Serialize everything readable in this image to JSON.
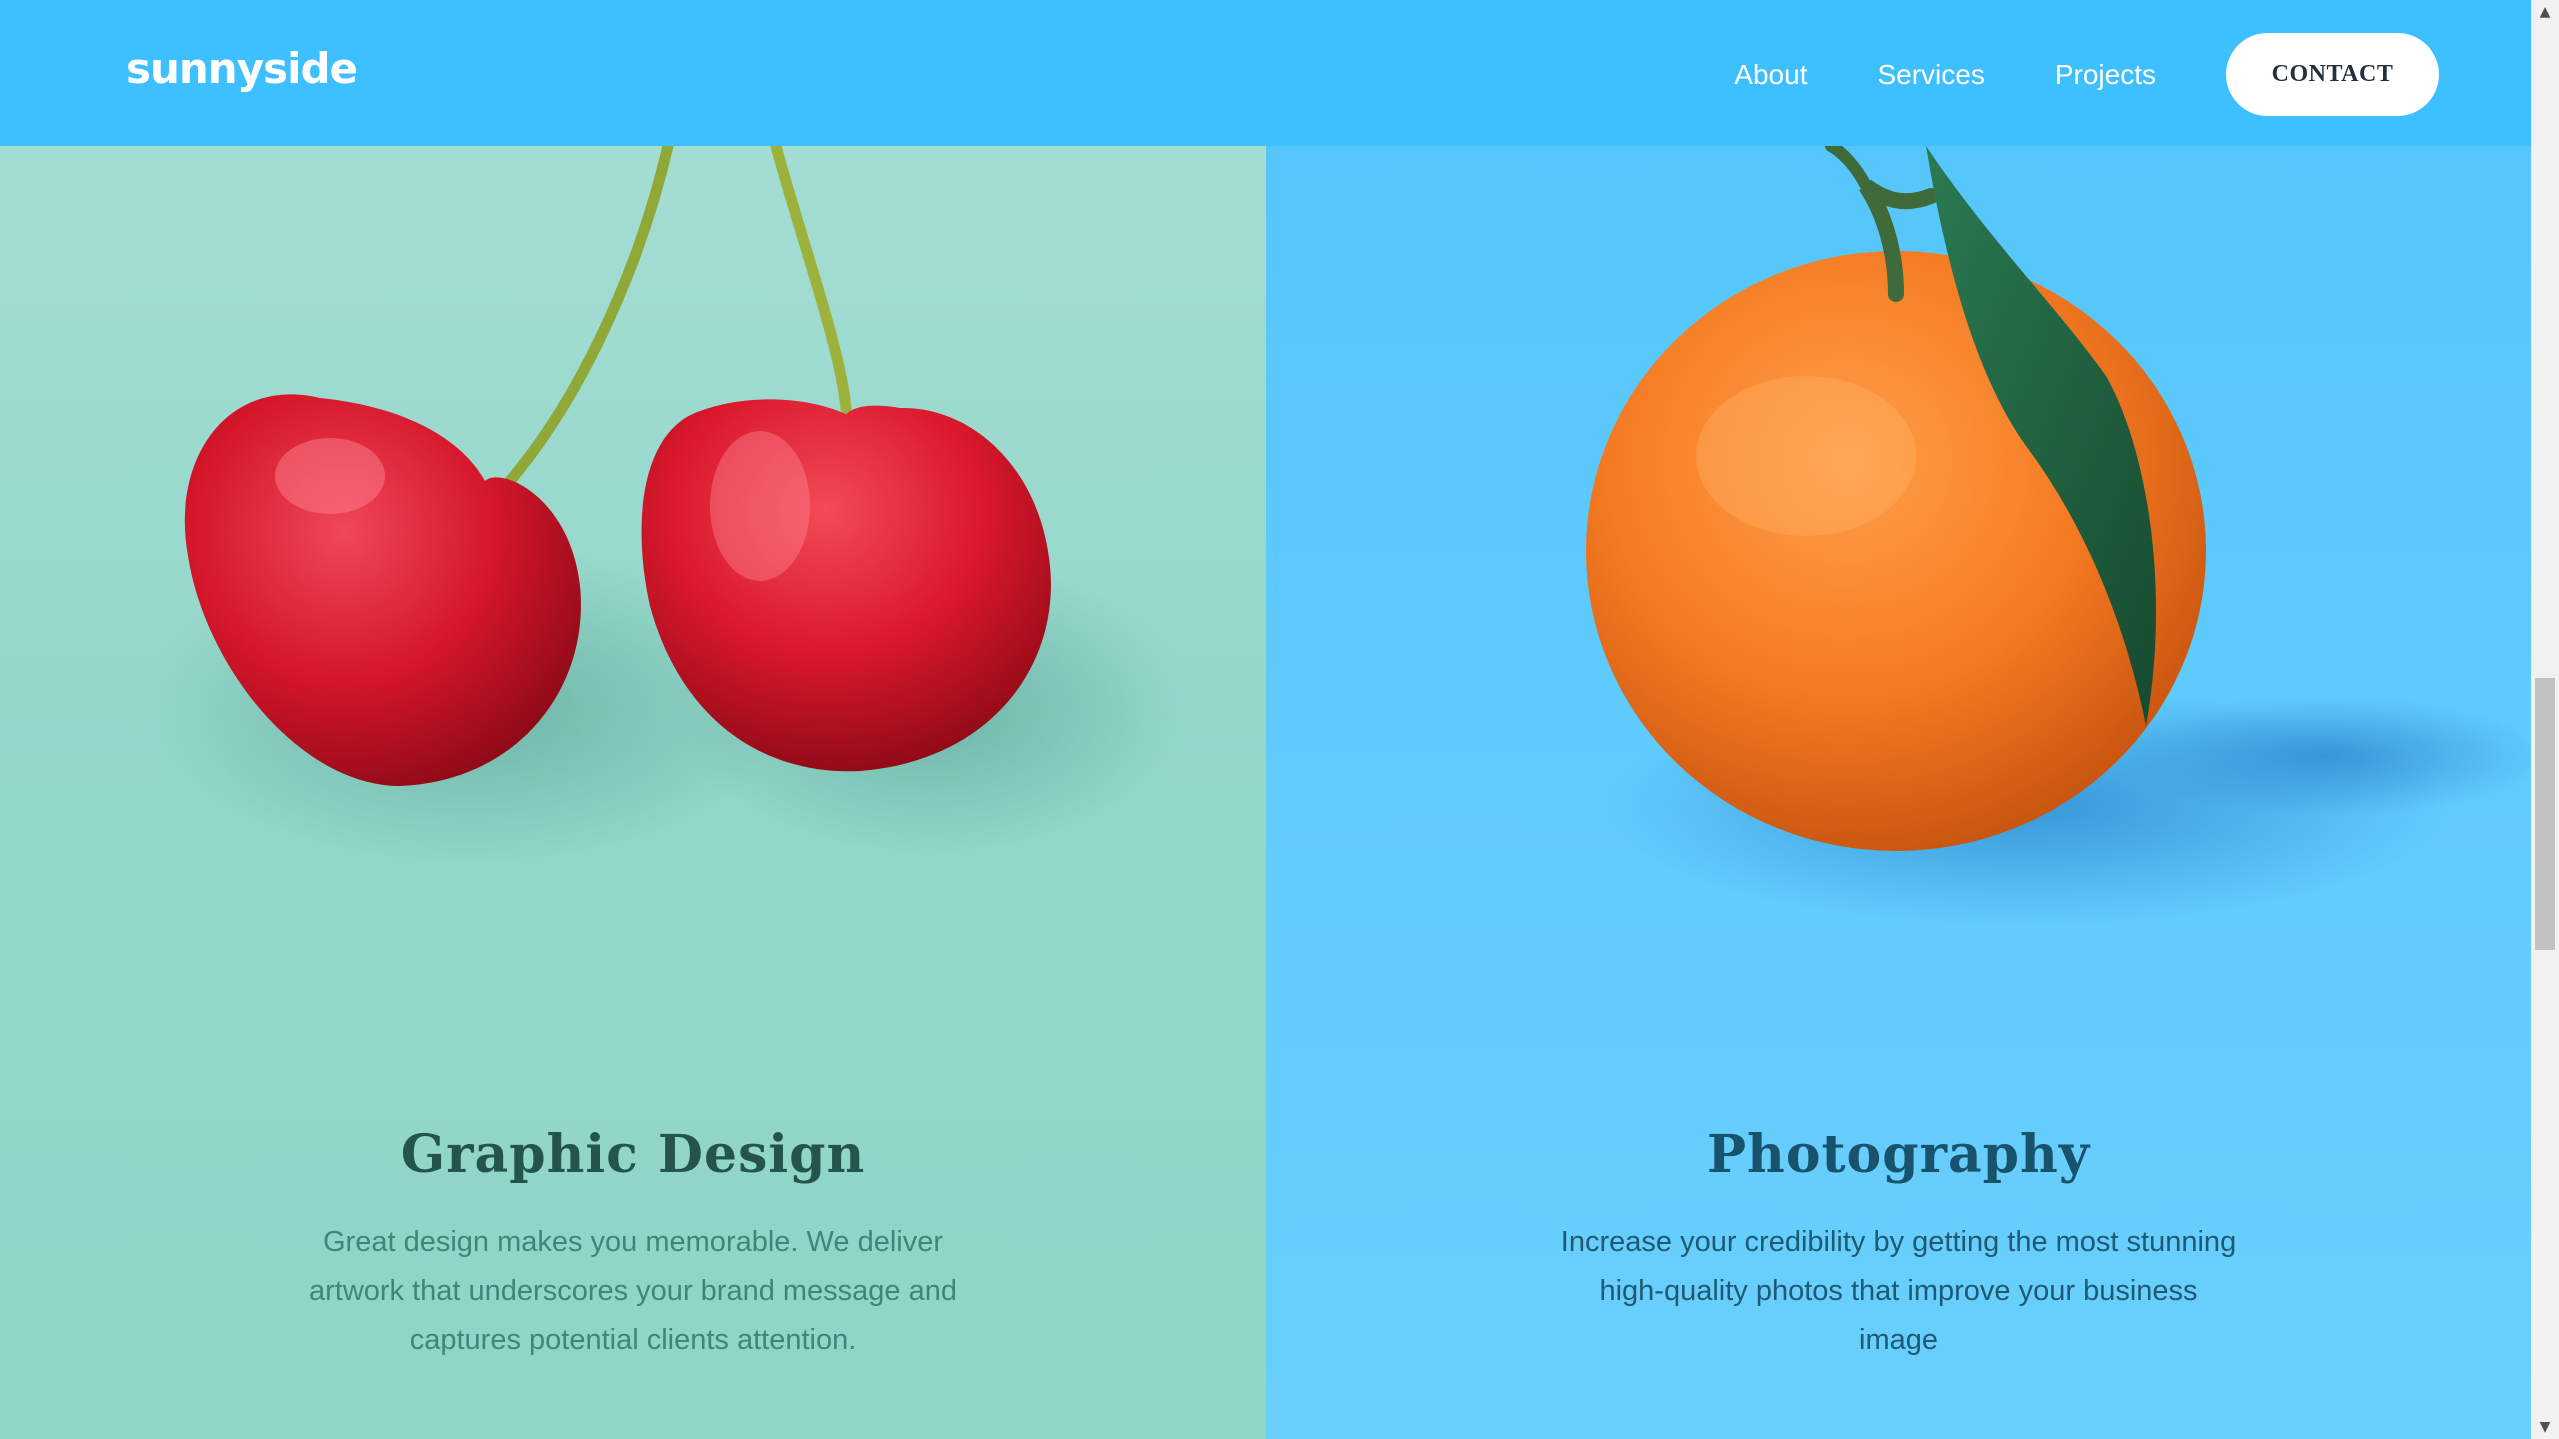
{
  "brand": {
    "logo_text": "sunnyside"
  },
  "nav": {
    "links": [
      "About",
      "Services",
      "Projects"
    ],
    "contact_label": "CONTACT"
  },
  "services": [
    {
      "title": "Graphic Design",
      "body": "Great design makes you memorable. We deliver artwork that underscores your brand message and captures potential clients attention.",
      "image": "cherries-image"
    },
    {
      "title": "Photography",
      "body": "Increase your credibility by getting the most stunning high-quality photos that improve your business image",
      "image": "orange-image"
    }
  ],
  "colors": {
    "header_bg": "#3ebfff",
    "graphic_bg": "#a3ddd3",
    "photo_bg": "#61cbfc",
    "graphic_title": "#24544b",
    "photo_title": "#19536b"
  }
}
